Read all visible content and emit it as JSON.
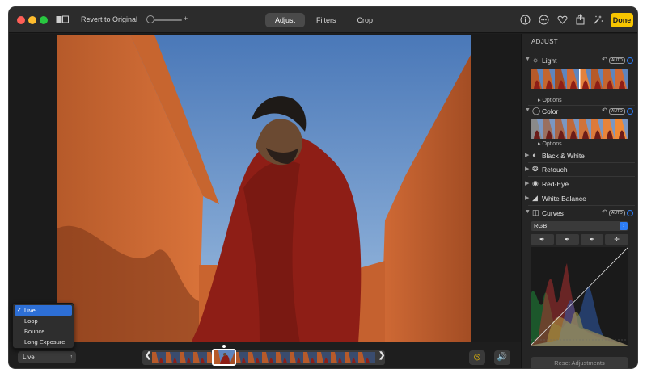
{
  "toolbar": {
    "revert_label": "Revert to Original",
    "zoom_plus": "+",
    "tabs": [
      {
        "label": "Adjust",
        "active": true
      },
      {
        "label": "Filters",
        "active": false
      },
      {
        "label": "Crop",
        "active": false
      }
    ],
    "done_label": "Done",
    "icons": [
      "info-icon",
      "more-icon",
      "heart-icon",
      "share-icon",
      "rotate-icon",
      "auto-enhance-icon"
    ]
  },
  "panel": {
    "title": "ADJUST",
    "auto_label": "AUTO",
    "options_label": "Options",
    "sections": {
      "light": "Light",
      "color": "Color",
      "bw": "Black & White",
      "retouch": "Retouch",
      "redeye": "Red-Eye",
      "wb": "White Balance",
      "curves": "Curves"
    },
    "curves_channel": "RGB",
    "reset_label": "Reset Adjustments"
  },
  "live": {
    "selected": "Live",
    "options": [
      "Live",
      "Loop",
      "Bounce",
      "Long Exposure"
    ]
  },
  "colors": {
    "accent": "#2d7df6",
    "done": "#f7c500",
    "window_bg": "#1e1e1e",
    "panel_bg": "#252525"
  }
}
